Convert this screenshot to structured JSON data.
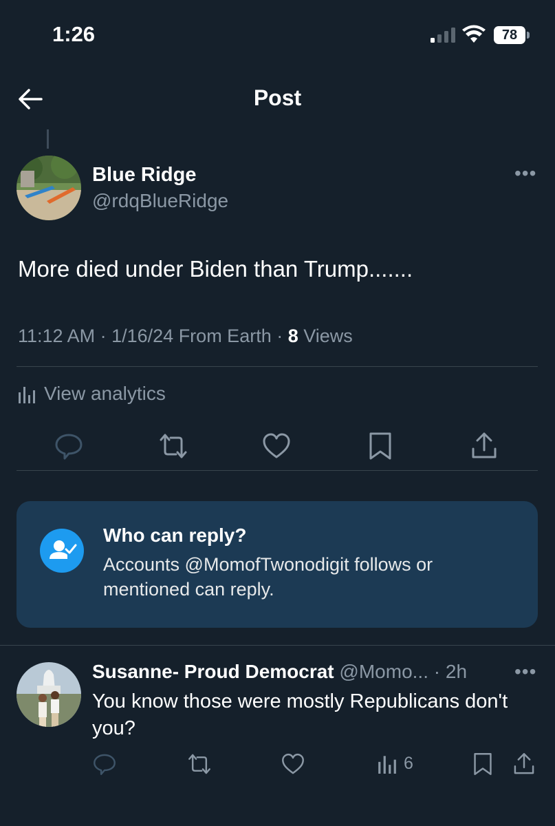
{
  "status_bar": {
    "time": "1:26",
    "battery": "78"
  },
  "header": {
    "title": "Post"
  },
  "post": {
    "author_name": "Blue Ridge",
    "author_handle": "@rdqBlueRidge",
    "text": "More died under Biden than Trump.......",
    "time": "11:12 AM",
    "date": "1/16/24",
    "source": "From Earth",
    "views_count": "8",
    "views_label": "Views",
    "analytics_label": "View analytics"
  },
  "reply_settings": {
    "title": "Who can reply?",
    "text": "Accounts @MomofTwonodigit follows or mentioned can reply."
  },
  "reply": {
    "author_name": "Susanne- Proud Democrat",
    "author_handle": "@Momo...",
    "age": "2h",
    "text": "You know those were mostly Republicans don't you?",
    "views": "6"
  },
  "colors": {
    "background": "#15202b",
    "secondary_text": "#8b98a5",
    "accent": "#1d9bf0",
    "reply_box": "#1c3a54"
  }
}
